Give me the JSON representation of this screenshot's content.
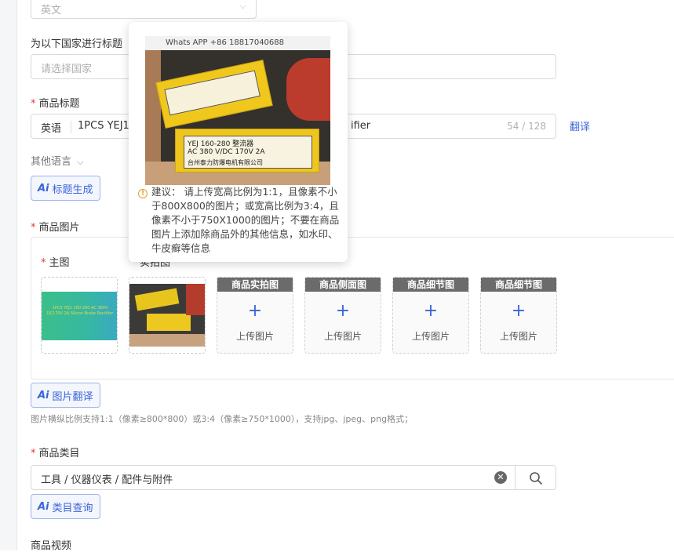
{
  "language_select": {
    "value": "英文"
  },
  "countries": {
    "label": "为以下国家进行标题",
    "placeholder": "请选择国家"
  },
  "title": {
    "label": "商品标题",
    "lang": "英语",
    "value_start": "1PCS YEJ1",
    "value_end": "ifier",
    "count": "54 / 128",
    "translate_label": "翻译"
  },
  "other_lang": {
    "label": "其他语言"
  },
  "ai_title_btn": {
    "badge": "Ai",
    "label": "标题生成"
  },
  "images": {
    "label": "商品图片",
    "main_label": "主图",
    "partial_label": "实拍图",
    "slots": [
      {
        "head": "商品实拍图",
        "text": "上传图片"
      },
      {
        "head": "商品侧面图",
        "text": "上传图片"
      },
      {
        "head": "商品细节图",
        "text": "上传图片"
      },
      {
        "head": "商品细节图",
        "text": "上传图片"
      }
    ],
    "thumb1_text": "1PCS YEJ1 160-280 AC 380V DC170V 2A Silicon Brake Rectifier"
  },
  "ai_image_btn": {
    "badge": "Ai",
    "label": "图片翻译"
  },
  "image_hint": "图片横纵比例支持1:1（像素≥800*800）或3:4（像素≥750*1000），支持jpg、jpeg、png格式；",
  "category": {
    "label": "商品类目",
    "value": "工具 / 仪器仪表 / 配件与附件"
  },
  "ai_category_btn": {
    "badge": "Ai",
    "label": "类目查询"
  },
  "video": {
    "label": "商品视频"
  },
  "popover": {
    "watermark": "Whats APP +86 18817040688",
    "label_top": "YEJ 160-280 整流器",
    "label_line2": "AC 380 V/DC 170V 2A",
    "label_line3": "台州泰力防爆电机有限公司",
    "advice": "建议： 请上传宽高比例为1:1，且像素不小于800X800的图片；或宽高比例为3:4，且像素不小于750X1000的图片；不要在商品图片上添加除商品外的其他信息，如水印、牛皮癣等信息"
  },
  "colors": {
    "accent": "#3a64d8",
    "required": "#e5393d",
    "ai_border": "#9fb4ea"
  },
  "icons": {
    "chevron": "chevron-down-icon",
    "warn": "warning-circle-icon",
    "clear": "clear-circle-icon",
    "search": "search-icon",
    "plus": "plus-icon"
  }
}
